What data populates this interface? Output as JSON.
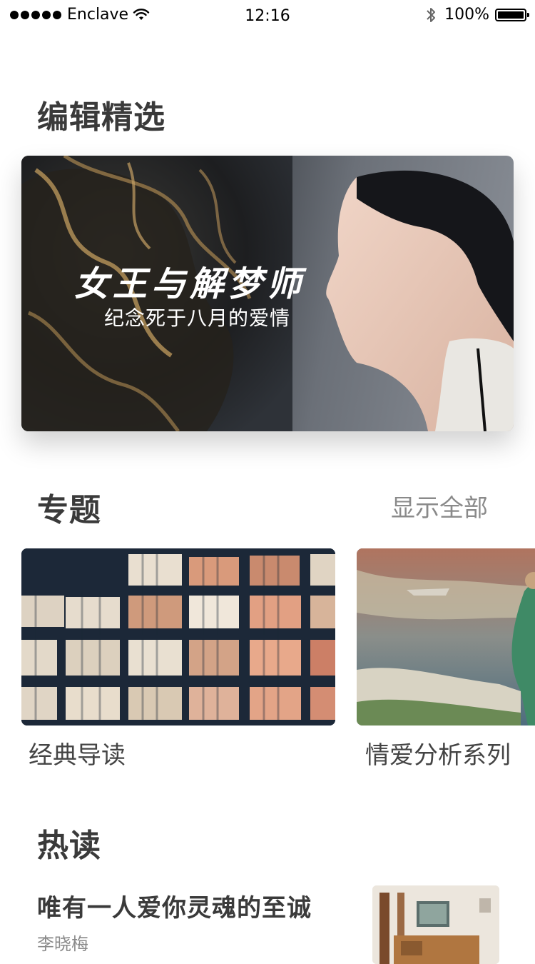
{
  "status_bar": {
    "carrier": "Enclave",
    "time": "12:16",
    "battery": "100%"
  },
  "editor_picks": {
    "title": "编辑精选",
    "hero_title": "女王与解梦师",
    "hero_subtitle": "纪念死于八月的爱情"
  },
  "topics": {
    "title": "专题",
    "show_all": "显示全部",
    "items": [
      {
        "label": "经典导读"
      },
      {
        "label": "情爱分析系列"
      }
    ]
  },
  "hot": {
    "title": "热读",
    "article": {
      "title": "唯有一人爱你灵魂的至诚",
      "author": "李晓梅"
    }
  },
  "icons": [
    "signal-dots-icon",
    "wifi-icon",
    "bluetooth-icon",
    "battery-icon"
  ]
}
